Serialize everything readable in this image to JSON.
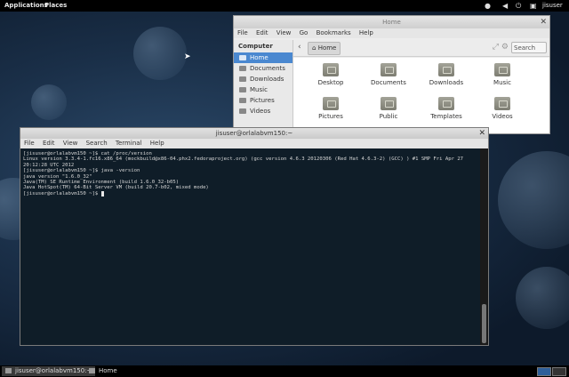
{
  "topbar": {
    "applications": "Applications",
    "places": "Places",
    "user": "jisuser",
    "icons": [
      "notification-icon",
      "volume-icon",
      "power-icon",
      "network-icon"
    ]
  },
  "file_manager": {
    "title": "Home",
    "menu": [
      "File",
      "Edit",
      "View",
      "Go",
      "Bookmarks",
      "Help"
    ],
    "sidebar_heading": "Computer",
    "sidebar_items": [
      {
        "label": "Home",
        "selected": true
      },
      {
        "label": "Documents"
      },
      {
        "label": "Downloads"
      },
      {
        "label": "Music"
      },
      {
        "label": "Pictures"
      },
      {
        "label": "Videos"
      }
    ],
    "location": "Home",
    "search_label": "Search",
    "folders": [
      "Desktop",
      "Documents",
      "Downloads",
      "Music",
      "Pictures",
      "Public",
      "Templates",
      "Videos"
    ]
  },
  "terminal": {
    "title": "jisuser@orlalabvm150:~",
    "menu": [
      "File",
      "Edit",
      "View",
      "Search",
      "Terminal",
      "Help"
    ],
    "lines": [
      "[jisuser@orlalabvm150 ~]$ cat /proc/version",
      "Linux version 3.3.4-1.fc16.x86_64 (mockbuild@x86-04.phx2.fedoraproject.org) (gcc version 4.6.3 20120306 (Red Hat 4.6.3-2) (GCC) ) #1 SMP Fri Apr 27 20:12:28 UTC 2012",
      "[jisuser@orlalabvm150 ~]$ java -version",
      "java version \"1.6.0_32\"",
      "Java(TM) SE Runtime Environment (build 1.6.0_32-b05)",
      "Java HotSpot(TM) 64-Bit Server VM (build 20.7-b02, mixed mode)",
      "[jisuser@orlalabvm150 ~]$ "
    ]
  },
  "taskbar": {
    "tasks": [
      "jisuser@orlalabvm150:~",
      "Home"
    ]
  }
}
